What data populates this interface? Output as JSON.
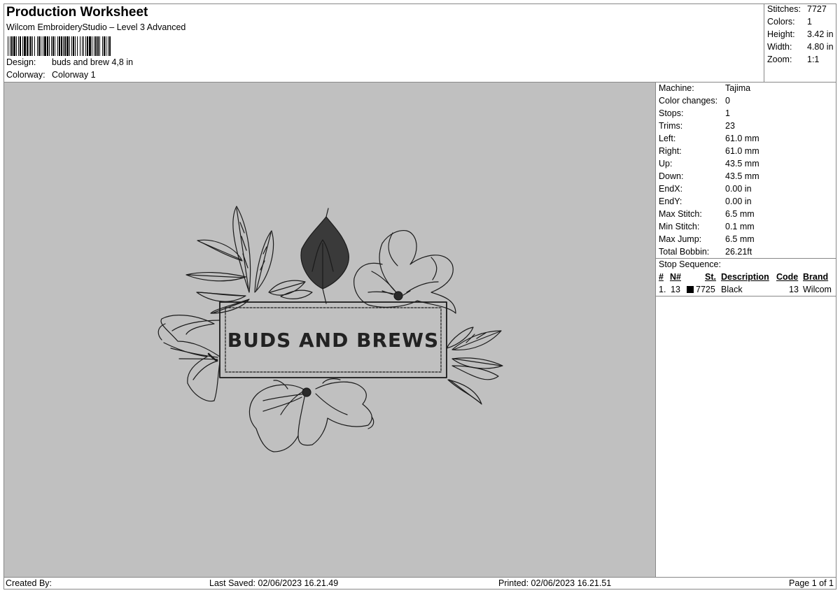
{
  "header": {
    "title": "Production Worksheet",
    "subtitle": "Wilcom EmbroideryStudio – Level 3 Advanced",
    "design_label": "Design:",
    "design_value": "buds and brew 4,8 in",
    "colorway_label": "Colorway:",
    "colorway_value": "Colorway 1"
  },
  "summary": {
    "stitches_label": "Stitches:",
    "stitches_value": "7727",
    "colors_label": "Colors:",
    "colors_value": "1",
    "height_label": "Height:",
    "height_value": "3.42 in",
    "width_label": "Width:",
    "width_value": "4.80 in",
    "zoom_label": "Zoom:",
    "zoom_value": "1:1"
  },
  "details": [
    {
      "label": "Machine:",
      "value": "Tajima"
    },
    {
      "label": "Color changes:",
      "value": "0"
    },
    {
      "label": "Stops:",
      "value": "1"
    },
    {
      "label": "Trims:",
      "value": "23"
    },
    {
      "label": "Left:",
      "value": "61.0 mm"
    },
    {
      "label": "Right:",
      "value": "61.0 mm"
    },
    {
      "label": "Up:",
      "value": "43.5 mm"
    },
    {
      "label": "Down:",
      "value": "43.5 mm"
    },
    {
      "label": "EndX:",
      "value": "0.00 in"
    },
    {
      "label": "EndY:",
      "value": "0.00 in"
    },
    {
      "label": "Max Stitch:",
      "value": "6.5 mm"
    },
    {
      "label": "Min Stitch:",
      "value": "0.1 mm"
    },
    {
      "label": "Max Jump:",
      "value": "6.5 mm"
    },
    {
      "label": "Total Bobbin:",
      "value": "26.21ft"
    }
  ],
  "stop_sequence": {
    "title": "Stop Sequence:",
    "headers": [
      "#",
      "N#",
      "St.",
      "Description",
      "Code",
      "Brand"
    ],
    "rows": [
      {
        "index": "1.",
        "needle": "13",
        "stitches": "7725",
        "description": "Black",
        "code": "13",
        "brand": "Wilcom",
        "color": "#000000"
      }
    ]
  },
  "design_text": "BUDS AND BREWS",
  "colors": {
    "canvas": "#c0c0c0",
    "thread": "#1a1a1a"
  },
  "footer": {
    "created_by": "Created By:",
    "last_saved": "Last Saved: 02/06/2023 16.21.49",
    "printed": "Printed: 02/06/2023 16.21.51",
    "page": "Page 1 of 1"
  }
}
